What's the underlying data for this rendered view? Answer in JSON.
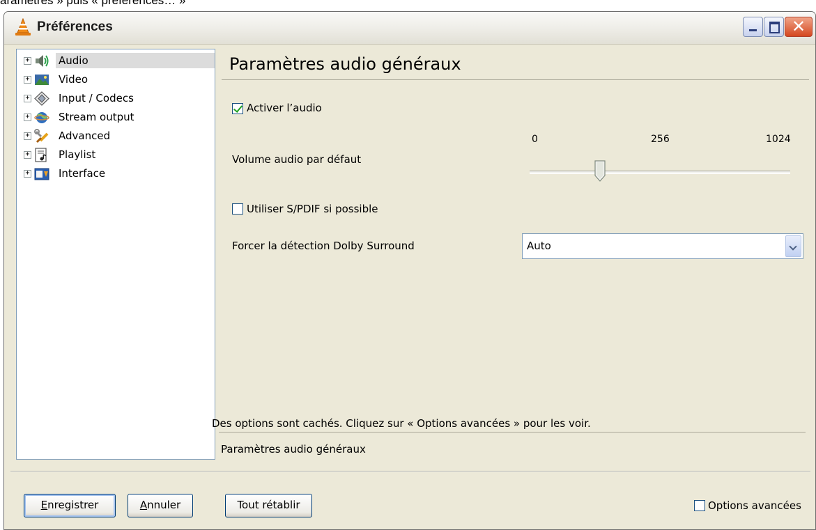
{
  "caption": "aramètres » puis « préférences… »",
  "window": {
    "title": "Préférences"
  },
  "tree": {
    "items": [
      {
        "label": "Audio",
        "icon": "speaker-icon",
        "selected": true
      },
      {
        "label": "Video",
        "icon": "video-icon",
        "selected": false
      },
      {
        "label": "Input / Codecs",
        "icon": "codecs-icon",
        "selected": false
      },
      {
        "label": "Stream output",
        "icon": "stream-output-icon",
        "selected": false
      },
      {
        "label": "Advanced",
        "icon": "advanced-icon",
        "selected": false
      },
      {
        "label": "Playlist",
        "icon": "playlist-icon",
        "selected": false
      },
      {
        "label": "Interface",
        "icon": "interface-icon",
        "selected": false
      }
    ]
  },
  "panel": {
    "title": "Paramètres audio généraux",
    "enable_audio": {
      "label": "Activer l’audio",
      "checked": true
    },
    "volume": {
      "label": "Volume audio par défaut",
      "ticks": [
        "0",
        "256",
        "1024"
      ],
      "value": 256,
      "min": 0,
      "max": 1024
    },
    "spdif": {
      "label": "Utiliser S/PDIF si possible",
      "checked": false
    },
    "dolby": {
      "label": "Forcer la détection Dolby Surround",
      "value": "Auto"
    }
  },
  "hint": "Des options sont cachés. Cliquez sur « Options avancées » pour les voir.",
  "description": "Paramètres audio généraux",
  "buttons": {
    "save": "Enregistrer",
    "save_mnemonic": "E",
    "cancel": "Annuler",
    "cancel_mnemonic": "A",
    "reset": "Tout rétablir"
  },
  "advanced_options": {
    "label": "Options avancées",
    "checked": false
  },
  "colors": {
    "selection": "#dcdcdc",
    "close_button": "#d5471f",
    "checkmark": "#21a121"
  }
}
